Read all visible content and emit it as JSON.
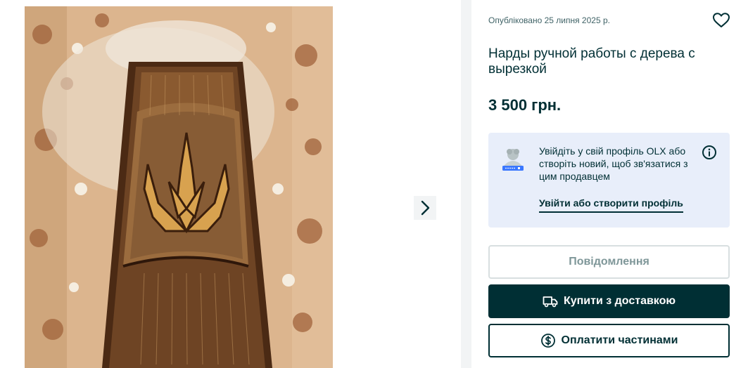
{
  "gallery": {
    "next_icon": "chevron-right-icon",
    "photo_alt": ""
  },
  "listing": {
    "published": "Опубліковано 25 липня 2025 р.",
    "title": "Нарды ручной работы с дерева с вырезкой",
    "price": "3 500 грн.",
    "favorite_icon": "heart-icon"
  },
  "login_prompt": {
    "text": "Увійдіть у свій профіль OLX або створіть новий, щоб зв'язатися з цим продавцем",
    "link": "Увійти або створити профіль",
    "info_icon": "info-icon"
  },
  "actions": {
    "message": "Повідомлення",
    "buy": "Купити з доставкою",
    "buy_icon": "truck-icon",
    "installments": "Оплатити частинами",
    "installments_icon": "dollar-circle-icon"
  },
  "colors": {
    "brand_dark": "#002f34",
    "login_box_bg": "#e8eefa",
    "page_gray": "#f2f4f5"
  }
}
